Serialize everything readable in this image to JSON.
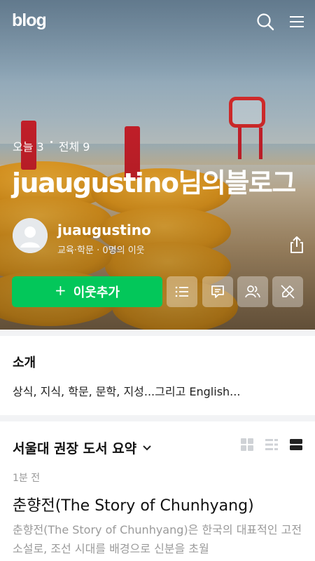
{
  "header": {
    "logo": "blog"
  },
  "hero": {
    "today_label": "오늘 3",
    "total_label": "전체 9",
    "blog_title": "juaugustino님의블로그",
    "owner_name": "juaugustino",
    "owner_meta": "교육·학문 · 0명의 이웃",
    "follow_plus": "+",
    "follow_label": "이웃추가"
  },
  "intro": {
    "title": "소개",
    "text": "상식, 지식, 학문, 문학, 지성...그리고 English..."
  },
  "category": {
    "title": "서울대 권장 도서 요약"
  },
  "post": {
    "time": "1분 전",
    "title": "춘향전(The Story of Chunhyang)",
    "snippet": "춘향전(The Story of Chunhyang)은 한국의 대표적인 고전 소설로, 조선 시대를 배경으로 신분을 초월"
  },
  "colors": {
    "accent": "#03c75a",
    "separator": "#f2f3f5"
  },
  "icons": [
    "search-icon",
    "menu-icon",
    "share-icon",
    "list-icon",
    "comment-icon",
    "people-icon",
    "no-edit-icon",
    "grid-view-icon",
    "list-view-icon",
    "card-view-icon",
    "chevron-down-icon"
  ]
}
